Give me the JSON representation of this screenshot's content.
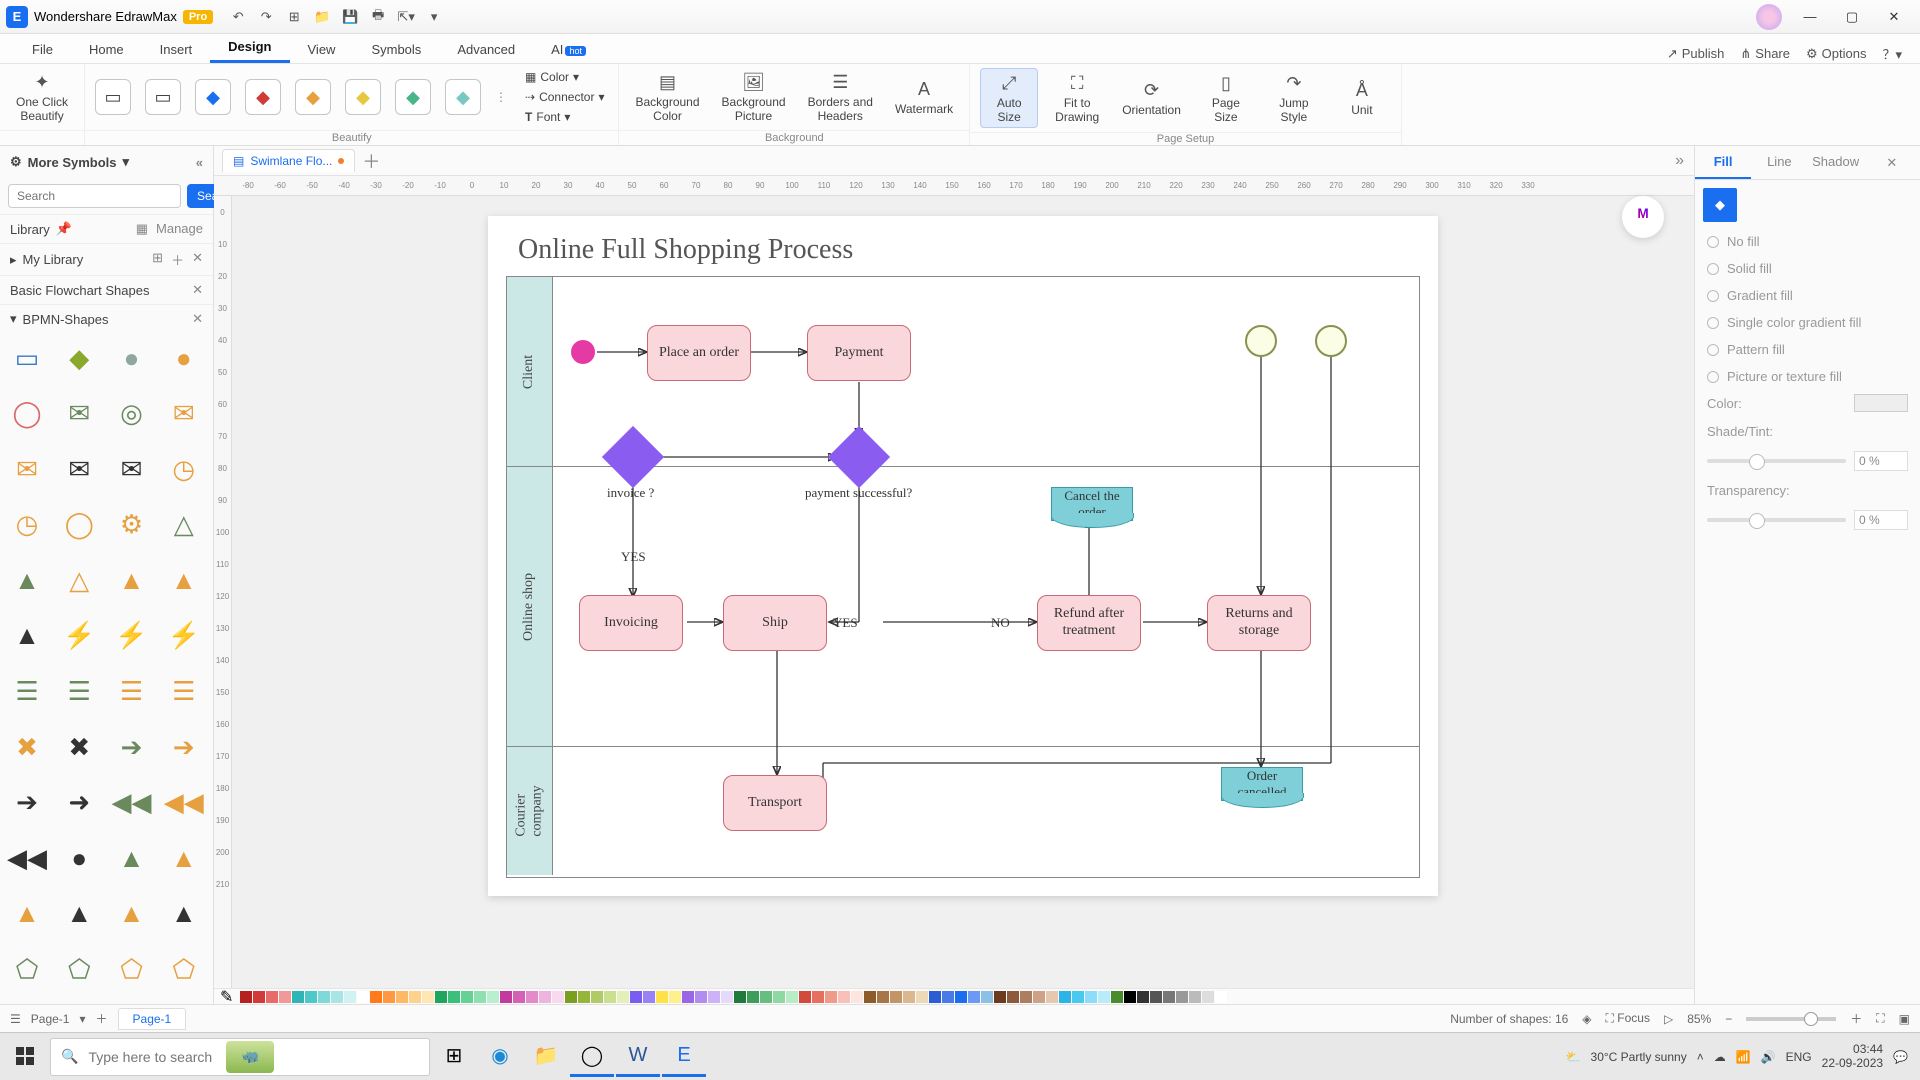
{
  "titlebar": {
    "app": "Wondershare EdrawMax",
    "pro": "Pro"
  },
  "menu": {
    "items": [
      "File",
      "Home",
      "Insert",
      "Design",
      "View",
      "Symbols",
      "Advanced",
      "AI"
    ],
    "active": 3,
    "ai_hot": "hot",
    "right": {
      "publish": "Publish",
      "share": "Share",
      "options": "Options"
    }
  },
  "ribbon": {
    "oneclick": "One Click\nBeautify",
    "group_beautify": "Beautify",
    "small": {
      "color": "Color",
      "connector": "Connector",
      "font": "Font"
    },
    "bg_color": "Background\nColor",
    "bg_pic": "Background\nPicture",
    "borders": "Borders and\nHeaders",
    "watermark": "Watermark",
    "group_background": "Background",
    "autosize": "Auto\nSize",
    "fit": "Fit to\nDrawing",
    "orient": "Orientation",
    "pagesize": "Page\nSize",
    "jump": "Jump\nStyle",
    "unit": "Unit",
    "group_pagesetup": "Page Setup"
  },
  "left": {
    "title": "More Symbols",
    "search_btn": "Search",
    "search_ph": "Search",
    "library": "Library",
    "manage": "Manage",
    "mylib": "My Library",
    "cat1": "Basic Flowchart Shapes",
    "cat2": "BPMN-Shapes"
  },
  "doc_tab": "Swimlane Flo...",
  "ruler_h": [
    "-80",
    "-60",
    "-50",
    "-40",
    "-30",
    "-20",
    "-10",
    "0",
    "10",
    "20",
    "30",
    "40",
    "50",
    "60",
    "70",
    "80",
    "90",
    "100",
    "110",
    "120",
    "130",
    "140",
    "150",
    "160",
    "170",
    "180",
    "190",
    "200",
    "210",
    "220",
    "230",
    "240",
    "250",
    "260",
    "270",
    "280",
    "290",
    "300",
    "310",
    "320",
    "330"
  ],
  "ruler_v": [
    "0",
    "10",
    "20",
    "30",
    "40",
    "50",
    "60",
    "70",
    "80",
    "90",
    "100",
    "110",
    "120",
    "130",
    "140",
    "150",
    "160",
    "170",
    "180",
    "190",
    "200",
    "210"
  ],
  "chart": {
    "title": "Online Full Shopping Process",
    "lanes": {
      "l1": "Client",
      "l2": "Online shop",
      "l3": "Courier\ncompany"
    },
    "n_place": "Place an\norder",
    "n_payment": "Payment",
    "q_invoice": "invoice ?",
    "q_pay": "payment successful?",
    "yes1": "YES",
    "yes2": "YES",
    "no": "NO",
    "n_invoice": "Invoicing",
    "n_ship": "Ship",
    "n_refund": "Refund after\ntreatment",
    "n_returns": "Returns and\nstorage",
    "n_cancel": "Cancel the\norder",
    "n_transport": "Transport",
    "n_ordercancel": "Order\ncancelled"
  },
  "rpanel": {
    "tab_fill": "Fill",
    "tab_line": "Line",
    "tab_shadow": "Shadow",
    "opts": [
      "No fill",
      "Solid fill",
      "Gradient fill",
      "Single color gradient fill",
      "Pattern fill",
      "Picture or texture fill"
    ],
    "color": "Color:",
    "shade": "Shade/Tint:",
    "transp": "Transparency:",
    "pct": "0 %"
  },
  "colorstrip": [
    "#b52020",
    "#d23a3a",
    "#e86a6a",
    "#f29898",
    "#2fb5b5",
    "#4ec9c9",
    "#7fd9d9",
    "#a8e6e6",
    "#d0f2f2",
    "#ffffff",
    "#ff7a1a",
    "#ff9840",
    "#ffb866",
    "#ffd28c",
    "#ffe6b3",
    "#1fa65e",
    "#3cbf78",
    "#66d194",
    "#8ee0b0",
    "#b8efce",
    "#c23a9e",
    "#d561b4",
    "#e38aca",
    "#efb3df",
    "#f8d9f0",
    "#7a9e1f",
    "#95b53c",
    "#b0cb66",
    "#cae08f",
    "#e3f0b8",
    "#7a5cf0",
    "#9a82f4",
    "#ffe14a",
    "#fff08c",
    "#9966e6",
    "#b38cef",
    "#ccb3f7",
    "#e6d9fb",
    "#1f7a3c",
    "#3c9e58",
    "#66bf80",
    "#8fd7a3",
    "#b8ecc6",
    "#d24a3a",
    "#e6705f",
    "#f09a8c",
    "#f7c1b8",
    "#fde4df",
    "#8c5a2b",
    "#a87646",
    "#c39566",
    "#dbb78f",
    "#efd8b8",
    "#2b5ed2",
    "#4a7ae6",
    "#1a6ef0",
    "#6a9af4",
    "#8cc1e6",
    "#6b3a1f",
    "#8c5a3c",
    "#ad7d5f",
    "#cda286",
    "#e6c8b0",
    "#2bb5e6",
    "#4ac9f0",
    "#8cddf7",
    "#b8ecfb",
    "#4a8c2b",
    "#000000",
    "#333333",
    "#555555",
    "#777777",
    "#999999",
    "#bbbbbb",
    "#dddddd",
    "#ffffff"
  ],
  "footer": {
    "pagesel": "Page-1",
    "pagetab": "Page-1",
    "shapes": "Number of shapes: 16",
    "focus": "Focus",
    "zoom": "85%"
  },
  "taskbar": {
    "search_ph": "Type here to search",
    "weather": "30°C  Partly sunny",
    "time": "03:44",
    "date": "22-09-2023"
  }
}
